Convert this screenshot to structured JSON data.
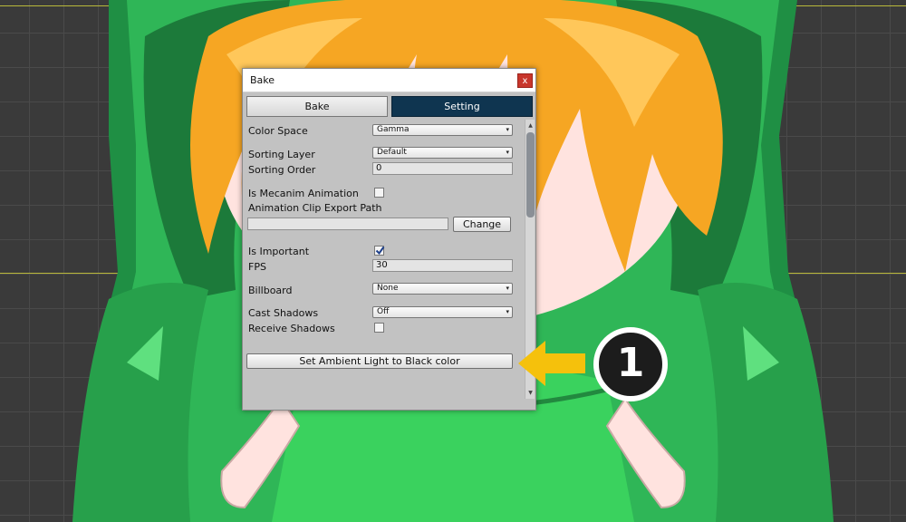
{
  "window": {
    "title": "Bake",
    "close_label": "x"
  },
  "tabs": [
    {
      "label": "Bake",
      "active": false
    },
    {
      "label": "Setting",
      "active": true
    }
  ],
  "settings": {
    "color_space": {
      "label": "Color Space",
      "value": "Gamma"
    },
    "sorting_layer": {
      "label": "Sorting Layer",
      "value": "Default"
    },
    "sorting_order": {
      "label": "Sorting Order",
      "value": "0"
    },
    "is_mecanim_animation": {
      "label": "Is Mecanim Animation",
      "checked": false
    },
    "animation_clip_export_path": {
      "label": "Animation Clip Export Path",
      "value": "",
      "button_label": "Change"
    },
    "is_important": {
      "label": "Is Important",
      "checked": true
    },
    "fps": {
      "label": "FPS",
      "value": "30"
    },
    "billboard": {
      "label": "Billboard",
      "value": "None"
    },
    "cast_shadows": {
      "label": "Cast Shadows",
      "value": "Off"
    },
    "receive_shadows": {
      "label": "Receive Shadows",
      "checked": false
    },
    "ambient_button_label": "Set Ambient Light to Black color"
  },
  "callout": {
    "number": "1",
    "arrow_color": "#f5c10c"
  },
  "colors": {
    "tab_active": "#0f3550",
    "close_button": "#c8362c",
    "hood_green": "#23a84b",
    "hair_orange": "#f6a623"
  }
}
